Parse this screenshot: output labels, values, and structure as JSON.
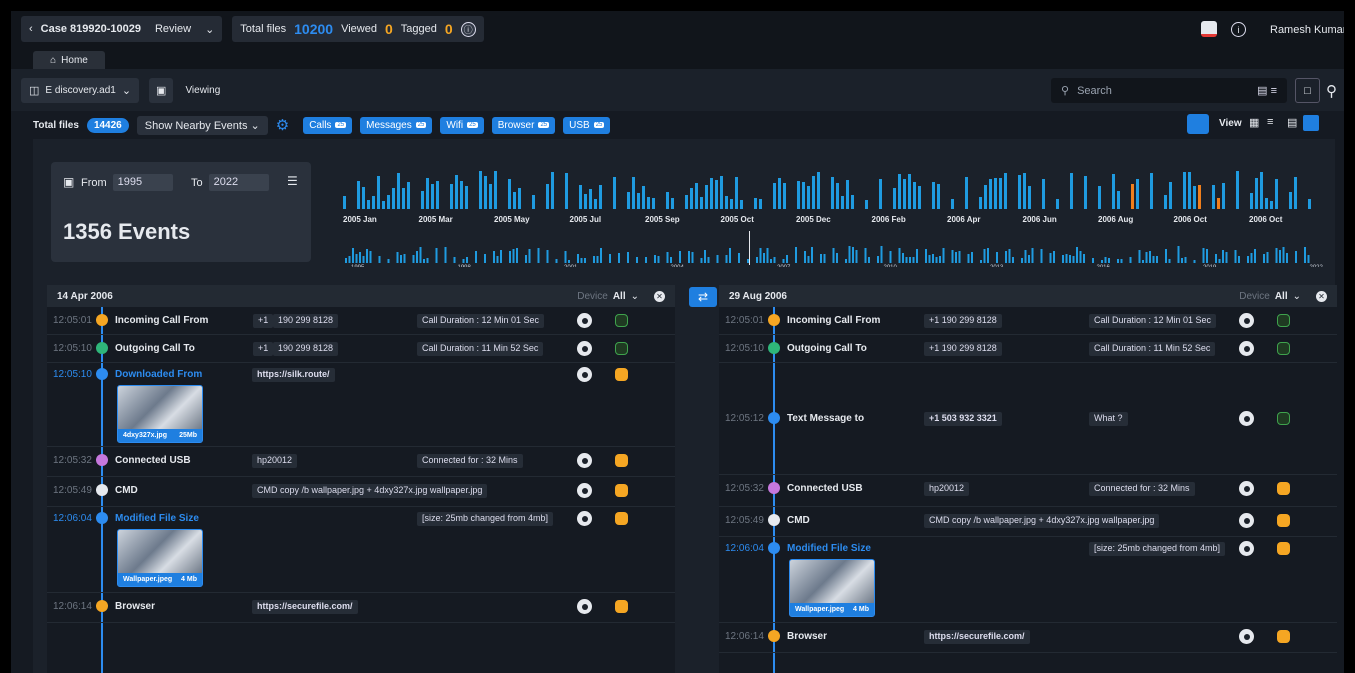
{
  "header": {
    "case": "Case 819920-10029",
    "mode": "Review",
    "total_label": "Total files",
    "total": "10200",
    "viewed_label": "Viewed",
    "viewed": "0",
    "tagged_label": "Tagged",
    "tagged": "0",
    "user": "Ramesh Kumar"
  },
  "tabs": {
    "home": "Home"
  },
  "toolbar": {
    "device": "E discovery.ad1",
    "viewing": "Viewing",
    "search_placeholder": "Search"
  },
  "filters": {
    "total_label": "Total files",
    "total": "14426",
    "nearby": "Show Nearby Events",
    "chips": [
      {
        "label": "Calls",
        "count": "25"
      },
      {
        "label": "Messages",
        "count": "25"
      },
      {
        "label": "Wifi",
        "count": "25"
      },
      {
        "label": "Browser",
        "count": "25"
      },
      {
        "label": "USB",
        "count": "25"
      }
    ],
    "view_label": "View"
  },
  "range": {
    "from_label": "From",
    "from": "1995",
    "to_label": "To",
    "to": "2022",
    "events": "1356 Events"
  },
  "chart_data": {
    "type": "bar",
    "top_labels": [
      "2005 Jan",
      "2005 Mar",
      "2005 May",
      "2005 Jul",
      "2005 Sep",
      "2005 Oct",
      "2005 Dec",
      "2006 Feb",
      "2006 Apr",
      "2006 Jun",
      "2006 Aug",
      "2006 Oct",
      "2006 Oct"
    ],
    "bottom_labels": [
      "1995",
      "1998",
      "2001",
      "2004",
      "2007",
      "2010",
      "2013",
      "2016",
      "2019",
      "2022"
    ],
    "colors": {
      "bar": "#1f9be0",
      "highlight": "#f07f1c"
    }
  },
  "left": {
    "date": "14 Apr 2006",
    "device_label": "Device",
    "device": "All",
    "rows": [
      {
        "time": "12:05:01",
        "label": "Incoming Call From",
        "v1": "+1",
        "v2": "190 299 8128",
        "v3": "Call Duration : 12 Min 01 Sec"
      },
      {
        "time": "12:05:10",
        "label": "Outgoing Call To",
        "v1": "+1",
        "v2": "190 299 8128",
        "v3": "Call Duration : 11 Min 52 Sec"
      },
      {
        "time": "12:05:10",
        "label": "Downloaded From",
        "v2": "https://silk.route/",
        "thumb": "4dxy327x.jpg",
        "size": "25Mb"
      },
      {
        "time": "12:05:32",
        "label": "Connected USB",
        "v2": "hp20012",
        "v3": "Connected for : 32 Mins"
      },
      {
        "time": "12:05:49",
        "label": "CMD",
        "v2": "CMD  copy /b wallpaper.jpg + 4dxy327x.jpg wallpaper.jpg"
      },
      {
        "time": "12:06:04",
        "label": "Modified File Size",
        "v3": "[size: 25mb changed from 4mb]",
        "thumb": "Wallpaper.jpeg",
        "size": "4 Mb"
      },
      {
        "time": "12:06:14",
        "label": "Browser",
        "v2": "https://securefile.com/"
      }
    ]
  },
  "right": {
    "date": "29 Aug 2006",
    "device_label": "Device",
    "device": "All",
    "rows": [
      {
        "time": "12:05:01",
        "label": "Incoming Call From",
        "v2": "+1 190 299 8128",
        "v3": "Call Duration : 12 Min 01 Sec"
      },
      {
        "time": "12:05:10",
        "label": "Outgoing Call To",
        "v2": "+1 190 299 8128",
        "v3": "Call Duration : 11 Min 52 Sec"
      },
      {
        "time": "12:05:12",
        "label": "Text Message to",
        "v2": "+1 503 932 3321",
        "v3": "What ?"
      },
      {
        "time": "12:05:32",
        "label": "Connected USB",
        "v2": "hp20012",
        "v3": "Connected for : 32 Mins"
      },
      {
        "time": "12:05:49",
        "label": "CMD",
        "v2": "CMD  copy /b wallpaper.jpg + 4dxy327x.jpg wallpaper.jpg"
      },
      {
        "time": "12:06:04",
        "label": "Modified File Size",
        "v3": "[size: 25mb changed from 4mb]",
        "thumb": "Wallpaper.jpeg",
        "size": "4 Mb"
      },
      {
        "time": "12:06:14",
        "label": "Browser",
        "v2": "https://securefile.com/"
      }
    ]
  }
}
